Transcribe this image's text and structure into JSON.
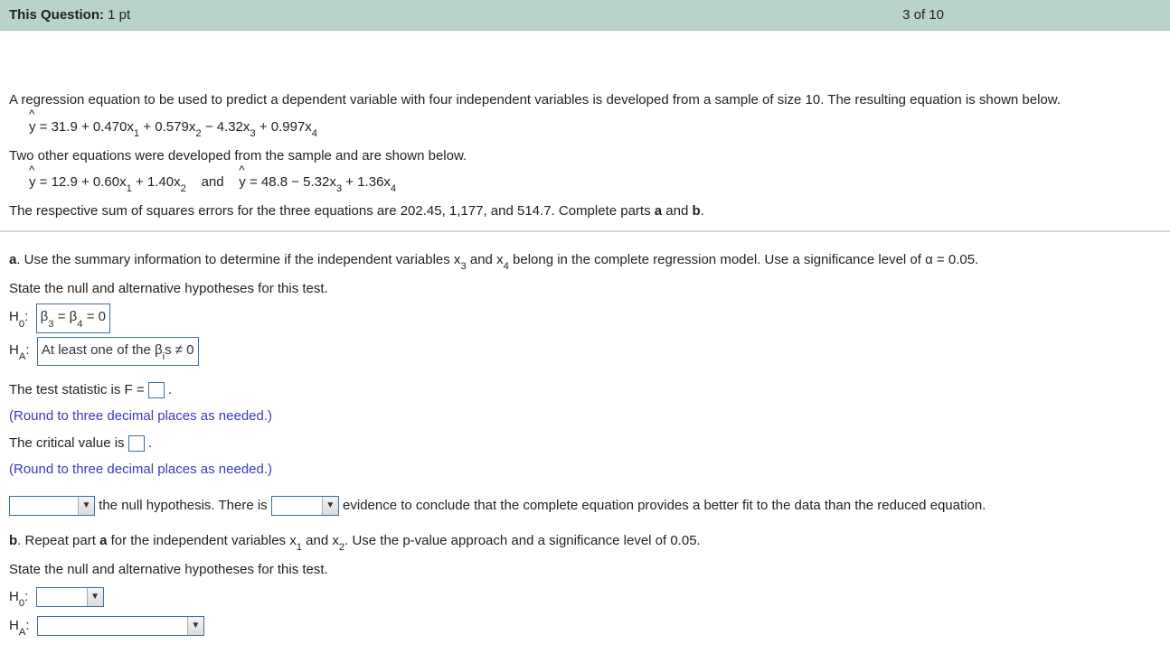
{
  "header": {
    "label": "This Question:",
    "points": "1 pt",
    "progress": "3 of 10"
  },
  "problem": {
    "intro": "A regression equation to be used to predict a dependent variable with four independent variables is developed from a sample of size 10. The resulting equation is shown below.",
    "eq1_text": " = 31.9 + 0.470x",
    "eq1_c2": " + 0.579x",
    "eq1_c3": " − 4.32x",
    "eq1_c4": " + 0.997x",
    "two_other": "Two other equations were developed from the sample and are shown below.",
    "eq2_text": " = 12.9 + 0.60x",
    "eq2_c2": " + 1.40x",
    "and": "and",
    "eq3_text": " = 48.8 − 5.32x",
    "eq3_c4": " + 1.36x",
    "sse_line_pre": "The respective sum of squares errors for the three equations are 202.45, 1,177, and 514.7. Complete parts ",
    "sse_a": "a",
    "sse_and": " and ",
    "sse_b": "b",
    "sse_end": "."
  },
  "partA": {
    "q_pre": ". Use the summary information to determine if the independent variables x",
    "q_mid": " and x",
    "q_post": " belong in the complete regression model. Use a significance level of α = 0.05.",
    "state": "State the null and alternative hypotheses for this test.",
    "h0_label": "H",
    "h0_sub": "0",
    "h0_val_pre": "β",
    "h0_val_mid": " = β",
    "h0_val_end": " = 0",
    "ha_label": "H",
    "ha_sub": "A",
    "ha_val_pre": "At least one of the β",
    "ha_val_sub": "i",
    "ha_val_end": "s ≠ 0",
    "test_stat": "The test statistic is F = ",
    "round": "(Round to three decimal places as needed.)",
    "crit": "The critical value is ",
    "conclusion_mid": " the null hypothesis. There is ",
    "conclusion_end": " evidence to conclude that the complete equation provides a better fit to the data than the reduced equation."
  },
  "partB": {
    "q_pre": ". Repeat part ",
    "q_a": "a",
    "q_mid1": " for the independent variables x",
    "q_mid2": " and x",
    "q_post": ". Use the p-value approach and a significance level of 0.05.",
    "state": "State the null and alternative hypotheses for this test."
  },
  "subs": {
    "s1": "1",
    "s2": "2",
    "s3": "3",
    "s4": "4"
  }
}
